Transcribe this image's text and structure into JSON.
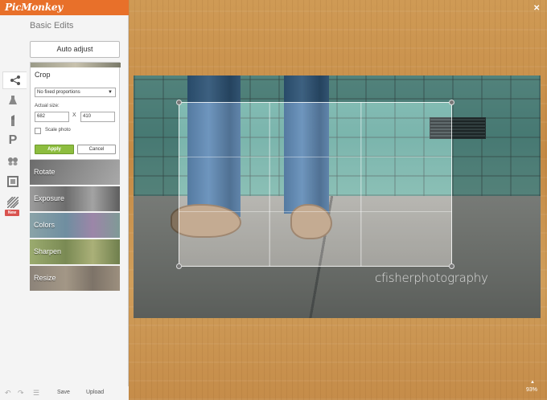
{
  "app": {
    "logo": "PicMonkey"
  },
  "sidebar": {
    "title": "Basic Edits",
    "tools": [
      {
        "name": "basic-edits",
        "icon": "crop-nodes-icon"
      },
      {
        "name": "effects",
        "icon": "flask-icon"
      },
      {
        "name": "touch-up",
        "icon": "lipstick-icon"
      },
      {
        "name": "text",
        "icon": "p-icon"
      },
      {
        "name": "overlays",
        "icon": "butterfly-icon"
      },
      {
        "name": "frames",
        "icon": "frame-icon"
      },
      {
        "name": "textures",
        "icon": "texture-icon",
        "badge": "New"
      }
    ],
    "auto_adjust": "Auto adjust",
    "crop": {
      "title": "Crop",
      "proportions": "No fixed proportions",
      "actual_size_label": "Actual size:",
      "width": "682",
      "height": "410",
      "separator": "X",
      "scale_label": "Scale photo",
      "apply": "Apply",
      "cancel": "Cancel"
    },
    "tiles": [
      "Rotate",
      "Exposure",
      "Colors",
      "Sharpen",
      "Resize"
    ]
  },
  "bottom_bar": {
    "save": "Save",
    "upload": "Upload"
  },
  "canvas": {
    "zoom": "93%",
    "watermark": "cfisherphotography"
  },
  "colors": {
    "brand": "#e8702a",
    "apply": "#8dbd3f"
  }
}
